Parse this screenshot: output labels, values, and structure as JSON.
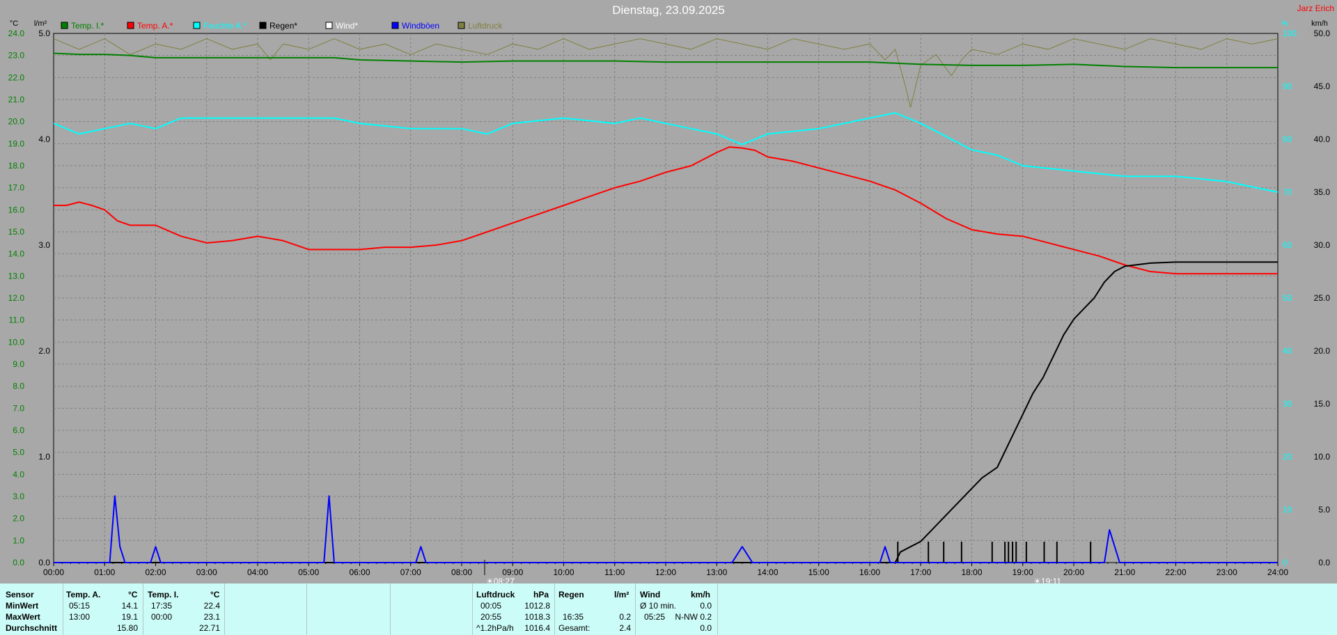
{
  "page": {
    "title": "Dienstag, 23.09.2025",
    "author": "Jarz Erich"
  },
  "legend": [
    {
      "label": "Temp. I.*",
      "color": "#008000"
    },
    {
      "label": "Temp. A.*",
      "color": "#ff0000"
    },
    {
      "label": "Feuchte A.*",
      "color": "#00ffff"
    },
    {
      "label": "Regen*",
      "color": "#000000"
    },
    {
      "label": "Wind*",
      "color": "#ffffff"
    },
    {
      "label": "Windböen",
      "color": "#0000ff"
    },
    {
      "label": "Luftdruck",
      "color": "#808040"
    }
  ],
  "axes": {
    "left_unit_temp": "°C",
    "left_unit_rain": "l/m²",
    "right_unit_hum": "%",
    "right_unit_wind": "km/h"
  },
  "markers": [
    {
      "label": "08:27",
      "time": 8.45
    },
    {
      "label": "19:11",
      "time": 19.183
    }
  ],
  "chart_data": {
    "type": "line",
    "x_unit": "hours",
    "xlim": [
      0,
      24
    ],
    "x_ticks": [
      "00:00",
      "01:00",
      "02:00",
      "03:00",
      "04:00",
      "05:00",
      "06:00",
      "07:00",
      "08:00",
      "09:00",
      "10:00",
      "11:00",
      "12:00",
      "13:00",
      "14:00",
      "15:00",
      "16:00",
      "17:00",
      "18:00",
      "19:00",
      "20:00",
      "21:00",
      "22:00",
      "23:00",
      "24:00"
    ],
    "temp_axis": {
      "ylim": [
        0,
        24
      ],
      "ticks": [
        "0.0",
        "1.0",
        "2.0",
        "3.0",
        "4.0",
        "5.0",
        "6.0",
        "7.0",
        "8.0",
        "9.0",
        "10.0",
        "11.0",
        "12.0",
        "13.0",
        "14.0",
        "15.0",
        "16.0",
        "17.0",
        "18.0",
        "19.0",
        "20.0",
        "21.0",
        "22.0",
        "23.0",
        "24.0"
      ]
    },
    "rain_axis": {
      "ylim": [
        0,
        5
      ],
      "ticks": [
        "0.0",
        "1.0",
        "2.0",
        "3.0",
        "4.0",
        "5.0"
      ]
    },
    "hum_axis": {
      "ylim": [
        0,
        100
      ],
      "ticks": [
        "0",
        "10",
        "20",
        "30",
        "40",
        "50",
        "60",
        "70",
        "80",
        "90",
        "100"
      ]
    },
    "wind_axis": {
      "ylim": [
        0,
        50
      ],
      "ticks": [
        "0.0",
        "5.0",
        "10.0",
        "15.0",
        "20.0",
        "25.0",
        "30.0",
        "35.0",
        "40.0",
        "45.0",
        "50.0"
      ]
    },
    "series": [
      {
        "name": "Temp. I.*",
        "axis": "temp",
        "color": "#008000",
        "x": [
          0,
          0.5,
          1,
          1.5,
          2,
          3,
          4,
          5,
          5.5,
          6,
          7,
          8,
          9,
          10,
          11,
          12,
          13,
          14,
          15,
          16,
          16.5,
          17,
          18,
          19,
          20,
          21,
          22,
          23,
          24
        ],
        "y": [
          23.1,
          23.05,
          23.05,
          23.0,
          22.9,
          22.9,
          22.9,
          22.9,
          22.9,
          22.8,
          22.75,
          22.7,
          22.75,
          22.75,
          22.75,
          22.7,
          22.7,
          22.7,
          22.7,
          22.7,
          22.65,
          22.6,
          22.55,
          22.55,
          22.6,
          22.5,
          22.45,
          22.45,
          22.45
        ]
      },
      {
        "name": "Temp. A.*",
        "axis": "temp",
        "color": "#ff0000",
        "x": [
          0,
          0.25,
          0.5,
          0.75,
          1,
          1.25,
          1.5,
          2,
          2.5,
          3,
          3.5,
          4,
          4.5,
          5,
          5.5,
          6,
          6.5,
          7,
          7.5,
          8,
          8.5,
          9,
          9.5,
          10,
          10.5,
          11,
          11.5,
          12,
          12.5,
          13,
          13.25,
          13.5,
          13.75,
          14,
          14.5,
          15,
          15.5,
          16,
          16.5,
          17,
          17.5,
          18,
          18.5,
          19,
          19.5,
          20,
          20.5,
          21,
          21.5,
          22,
          23,
          24
        ],
        "y": [
          16.2,
          16.2,
          16.35,
          16.2,
          16.0,
          15.5,
          15.3,
          15.3,
          14.8,
          14.5,
          14.6,
          14.8,
          14.6,
          14.2,
          14.2,
          14.2,
          14.3,
          14.3,
          14.4,
          14.6,
          15.0,
          15.4,
          15.8,
          16.2,
          16.6,
          17.0,
          17.3,
          17.7,
          18.0,
          18.6,
          18.85,
          18.8,
          18.7,
          18.4,
          18.2,
          17.9,
          17.6,
          17.3,
          16.9,
          16.3,
          15.6,
          15.1,
          14.9,
          14.8,
          14.5,
          14.2,
          13.9,
          13.5,
          13.2,
          13.1,
          13.1,
          13.1
        ]
      },
      {
        "name": "Feuchte A.*",
        "axis": "hum",
        "color": "#00ffff",
        "x": [
          0,
          0.5,
          1,
          1.5,
          2,
          2.5,
          3,
          4,
          5,
          5.5,
          6,
          7,
          8,
          8.5,
          9,
          10,
          11,
          11.5,
          12,
          13,
          13.5,
          14,
          15,
          16,
          16.5,
          17,
          18,
          18.5,
          19,
          20,
          21,
          22,
          23,
          24
        ],
        "y": [
          83,
          81,
          82,
          83,
          82,
          84,
          84,
          84,
          84,
          84,
          83,
          82,
          82,
          81,
          83,
          84,
          83,
          84,
          83,
          81,
          79,
          81,
          82,
          84,
          85,
          83,
          78,
          77,
          75,
          74,
          73,
          73,
          72,
          70
        ]
      },
      {
        "name": "Regen*",
        "axis": "rain",
        "color": "#000000",
        "x": [
          0,
          16.5,
          16.6,
          16.8,
          17,
          17.2,
          17.5,
          17.8,
          18,
          18.2,
          18.5,
          18.7,
          19,
          19.2,
          19.4,
          19.6,
          19.8,
          20,
          20.2,
          20.4,
          20.6,
          20.8,
          21,
          21.5,
          22,
          23,
          24
        ],
        "y": [
          0,
          0,
          0.1,
          0.15,
          0.2,
          0.3,
          0.45,
          0.6,
          0.7,
          0.8,
          0.9,
          1.1,
          1.4,
          1.6,
          1.75,
          1.95,
          2.15,
          2.3,
          2.4,
          2.5,
          2.65,
          2.75,
          2.8,
          2.83,
          2.84,
          2.84,
          2.84
        ]
      },
      {
        "name": "Windböen",
        "axis": "wind",
        "color": "#0000ff",
        "x": [
          0,
          1.1,
          1.2,
          1.3,
          1.4,
          1.5,
          1.9,
          2.0,
          2.1,
          5.3,
          5.4,
          5.5,
          7.1,
          7.2,
          7.3,
          13.3,
          13.5,
          13.7,
          16.2,
          16.3,
          16.4,
          20.6,
          20.7,
          20.9,
          24
        ],
        "y": [
          0,
          0,
          6.3,
          1.5,
          0,
          0,
          0,
          1.5,
          0,
          0,
          6.3,
          0,
          0,
          1.5,
          0,
          0,
          1.5,
          0,
          0,
          1.5,
          0,
          0,
          3.1,
          0,
          0
        ]
      }
    ],
    "pressure": {
      "name": "Luftdruck",
      "color": "#808040",
      "x": [
        0,
        0.5,
        1,
        1.5,
        2,
        2.5,
        3,
        3.5,
        4,
        4.25,
        4.5,
        5,
        5.5,
        6,
        6.5,
        7,
        7.5,
        8,
        8.5,
        9,
        9.5,
        10,
        10.5,
        11,
        11.5,
        12,
        12.5,
        13,
        13.5,
        14,
        14.5,
        15,
        15.5,
        16,
        16.3,
        16.5,
        16.7,
        16.8,
        17,
        17.3,
        17.6,
        17.8,
        18,
        18.5,
        19,
        19.5,
        20,
        20.5,
        21,
        21.5,
        22,
        22.5,
        23,
        23.5,
        24
      ],
      "y": [
        99,
        97,
        99,
        96,
        98,
        97,
        99,
        97,
        98,
        95,
        98,
        97,
        99,
        97,
        98,
        96,
        98,
        97,
        96,
        98,
        97,
        99,
        97,
        98,
        99,
        98,
        97,
        99,
        98,
        97,
        99,
        98,
        97,
        98,
        95,
        97,
        90,
        86,
        94,
        96,
        92,
        95,
        97,
        96,
        98,
        97,
        99,
        98,
        97,
        99,
        98,
        97,
        99,
        98,
        99
      ]
    },
    "rain_events_x": [
      16.55,
      17.15,
      17.45,
      17.8,
      18.4,
      18.65,
      18.72,
      18.8,
      18.87,
      19.07,
      19.42,
      19.67,
      20.33
    ]
  },
  "stats": {
    "row_labels": [
      "Sensor",
      "MinWert",
      "MaxWert",
      "Durchschnitt"
    ],
    "temp_a": {
      "header": "Temp. A.",
      "unit": "°C",
      "min_time": "05:15",
      "min": "14.1",
      "max_time": "13:00",
      "max": "19.1",
      "avg": "15.80"
    },
    "temp_i": {
      "header": "Temp. I.",
      "unit": "°C",
      "min_time": "17:35",
      "min": "22.4",
      "max_time": "00:00",
      "max": "23.1",
      "avg": "22.71"
    },
    "luftdruck": {
      "header": "Luftdruck",
      "unit": "hPa",
      "min_time": "00:05",
      "min": "1012.8",
      "max_time": "20:55",
      "max": "1018.3",
      "trend_label": "^1.2hPa/h",
      "trend": "1016.4"
    },
    "regen": {
      "header": "Regen",
      "unit": "l/m²",
      "max_time": "16:35",
      "max": "0.2",
      "total_label": "Gesamt:",
      "total": "2.4"
    },
    "wind": {
      "header": "Wind",
      "unit": "km/h",
      "avg_label": "Ø 10 min.",
      "avg": "0.0",
      "max_time": "05:25",
      "max": "N-NW 0.2",
      "avg2": "0.0"
    }
  }
}
